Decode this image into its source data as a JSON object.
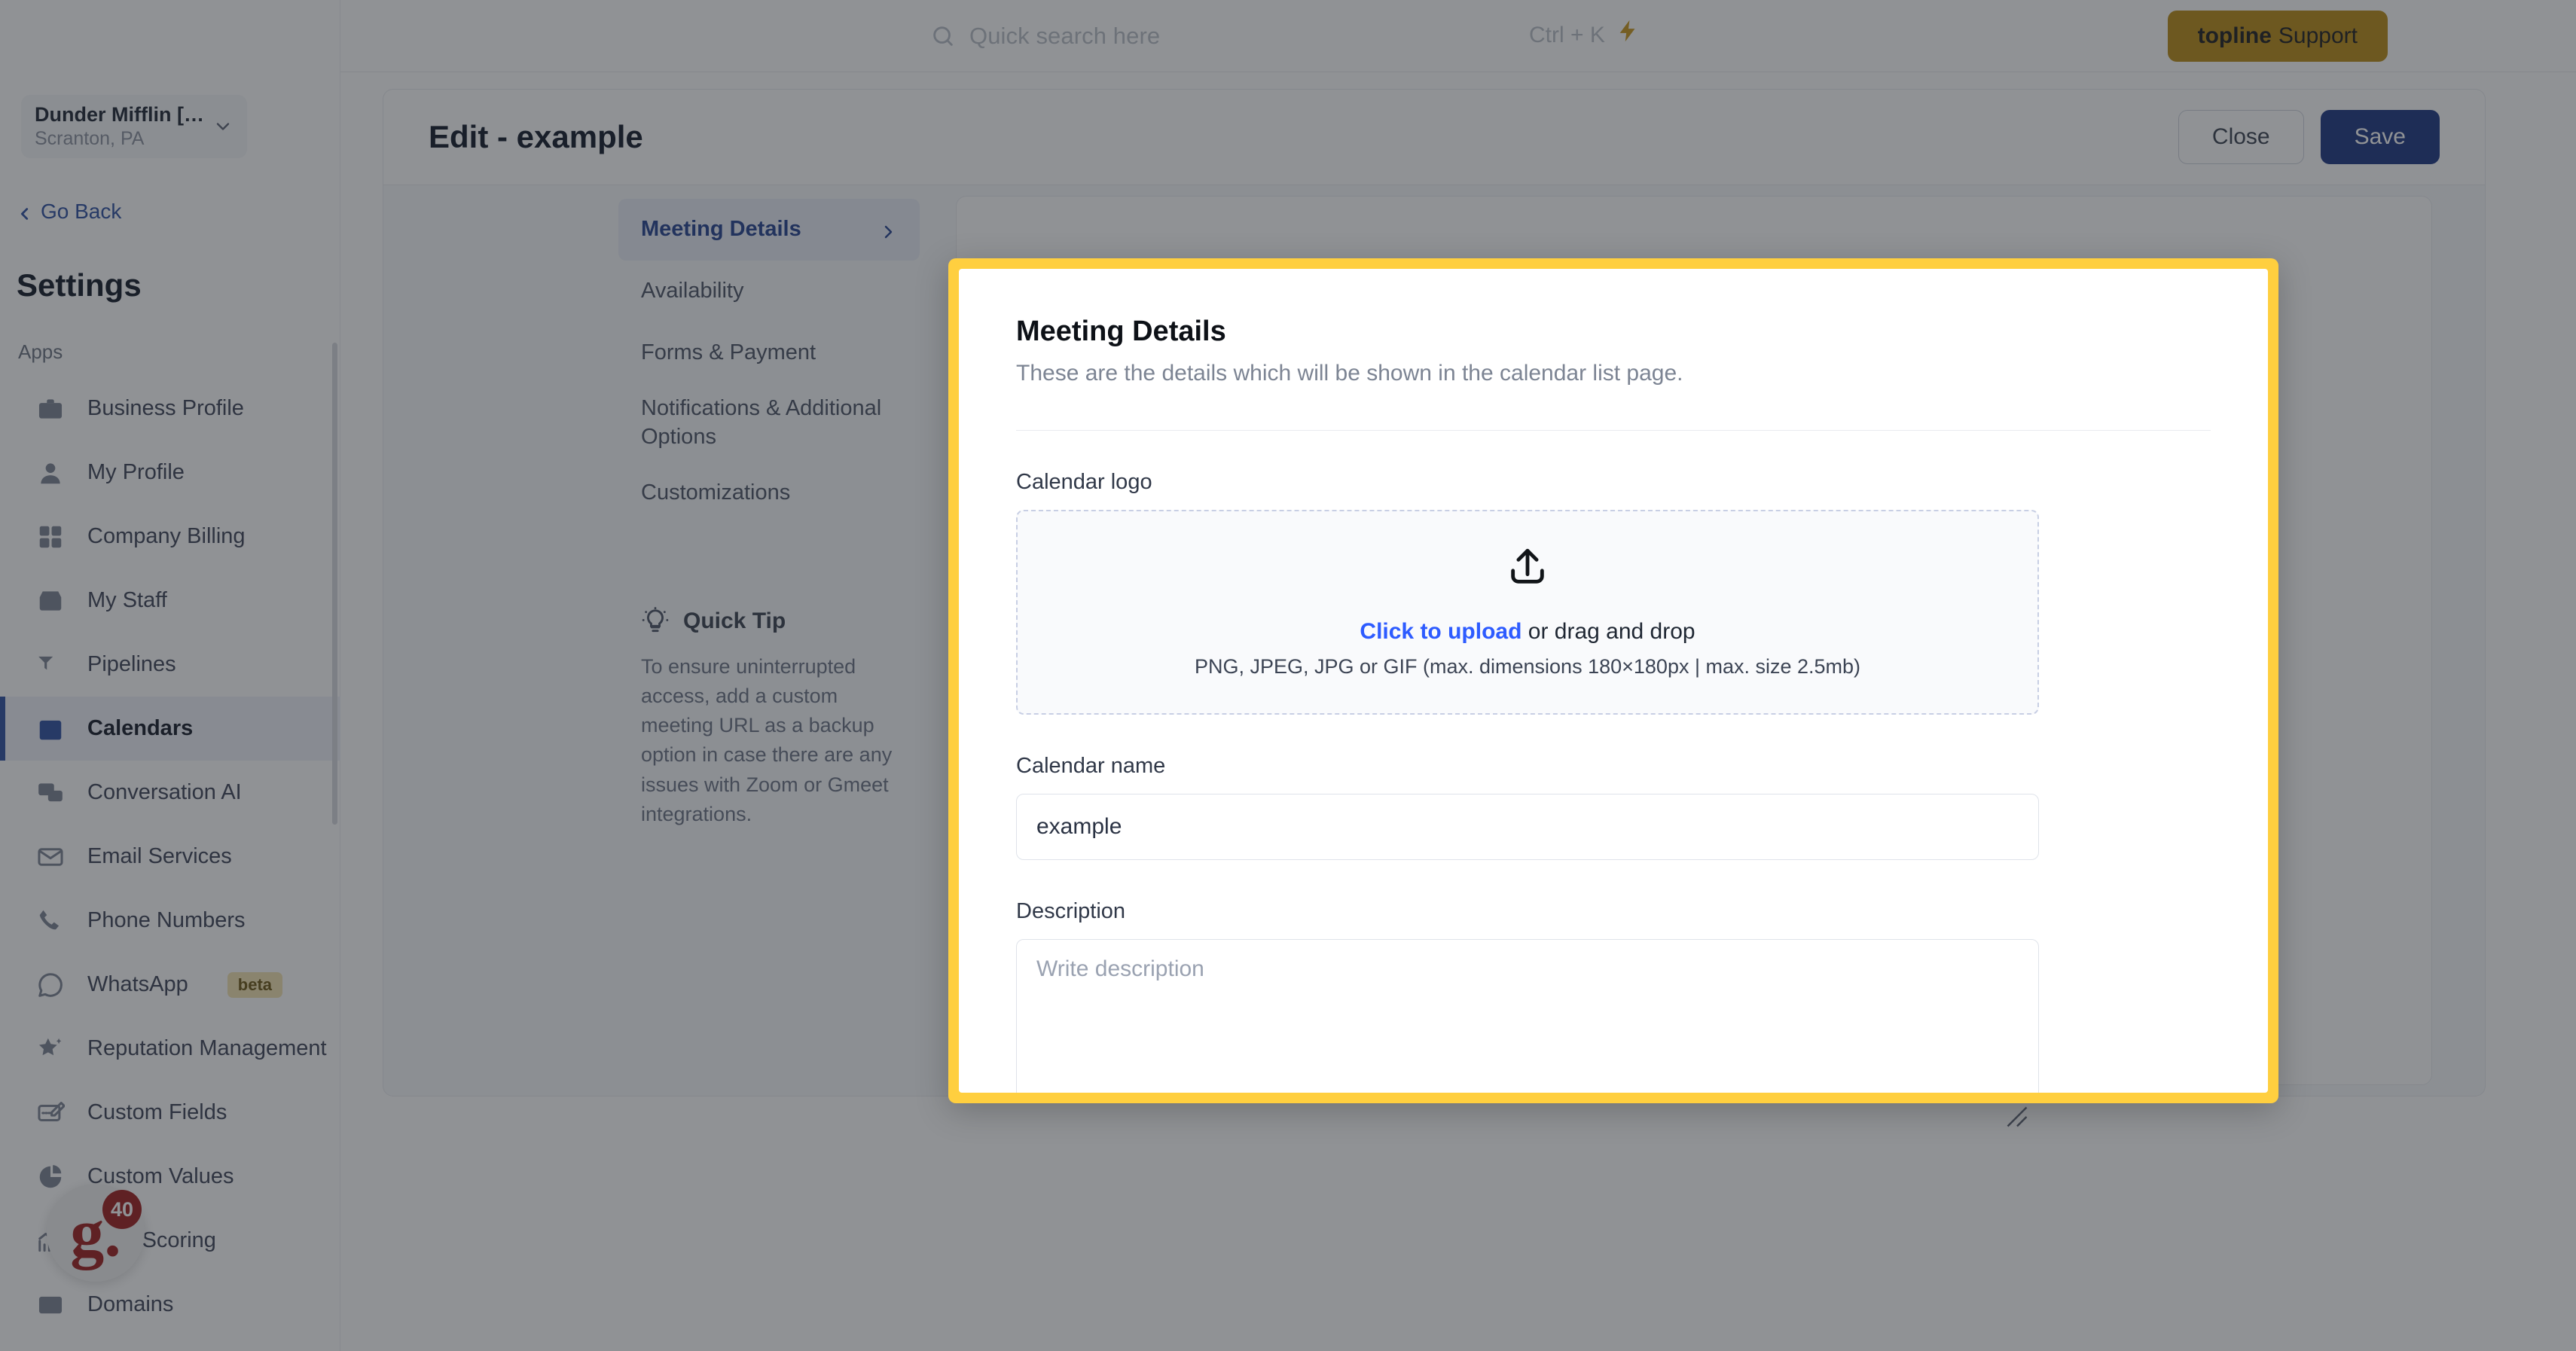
{
  "topbar": {
    "search_placeholder": "Quick search here",
    "search_icon": "search-icon",
    "shortcut_hint": "Ctrl + K",
    "bolt_icon": "lightning-bolt-icon",
    "support_brand": "topline",
    "support_label": "Support",
    "support_bg": "#b98b15"
  },
  "sidebar": {
    "location_name": "Dunder Mifflin [D...",
    "location_sub": "Scranton, PA",
    "location_chevron": "chevron-down-icon",
    "go_back": "Go Back",
    "go_back_icon": "chevron-left-icon",
    "title": "Settings",
    "group_label": "Apps",
    "accent": "#2c4fa0",
    "items": [
      {
        "label": "Business Profile",
        "icon": "briefcase-icon",
        "active": false
      },
      {
        "label": "My Profile",
        "icon": "user-icon",
        "active": false
      },
      {
        "label": "Company Billing",
        "icon": "calculator-icon",
        "active": false
      },
      {
        "label": "My Staff",
        "icon": "inbox-icon",
        "active": false
      },
      {
        "label": "Pipelines",
        "icon": "filter-icon",
        "active": false
      },
      {
        "label": "Calendars",
        "icon": "calendar-icon",
        "active": true
      },
      {
        "label": "Conversation AI",
        "icon": "chat-bubbles-icon",
        "active": false
      },
      {
        "label": "Email Services",
        "icon": "envelope-icon",
        "active": false
      },
      {
        "label": "Phone Numbers",
        "icon": "phone-icon",
        "active": false
      },
      {
        "label": "WhatsApp",
        "icon": "whatsapp-icon",
        "active": false,
        "badge": "beta"
      },
      {
        "label": "Reputation Management",
        "icon": "star-sparkle-icon",
        "active": false
      },
      {
        "label": "Custom Fields",
        "icon": "edit-field-icon",
        "active": false
      },
      {
        "label": "Custom Values",
        "icon": "pie-chart-icon",
        "active": false
      },
      {
        "label": "Lead Scoring",
        "icon": "chart-up-icon",
        "active": false
      },
      {
        "label": "Domains",
        "icon": "browser-icon",
        "active": false
      }
    ]
  },
  "help_widget": {
    "logo_letter": "g.",
    "count": "40",
    "color": "#9c1c1c"
  },
  "page": {
    "title": "Edit - example",
    "close_label": "Close",
    "save_label": "Save",
    "save_color": "#1b3480"
  },
  "tabs": [
    {
      "label": "Meeting Details",
      "active": true,
      "chevron": "chevron-right-icon"
    },
    {
      "label": "Availability",
      "active": false
    },
    {
      "label": "Forms & Payment",
      "active": false
    },
    {
      "label": "Notifications & Additional Options",
      "active": false
    },
    {
      "label": "Customizations",
      "active": false
    }
  ],
  "quick_tip": {
    "icon": "lightbulb-icon",
    "title": "Quick Tip",
    "body": "To ensure uninterrupted access, add a custom meeting URL as a backup option in case there are any issues with Zoom or Gmeet integrations."
  },
  "modal": {
    "highlight_color": "#ffcf3f",
    "title": "Meeting Details",
    "subtitle": "These are the details which will be shown in the calendar list page.",
    "logo_label": "Calendar logo",
    "upload_icon": "upload-icon",
    "upload_link": "Click to upload",
    "upload_rest": " or drag and drop",
    "upload_hint": "PNG, JPEG, JPG or GIF (max. dimensions 180×180px | max. size 2.5mb)",
    "name_label": "Calendar name",
    "name_value": "example",
    "name_placeholder": "Calendar name",
    "description_label": "Description",
    "description_value": "",
    "description_placeholder": "Write description",
    "resize_handle": "resize-grip-icon"
  }
}
